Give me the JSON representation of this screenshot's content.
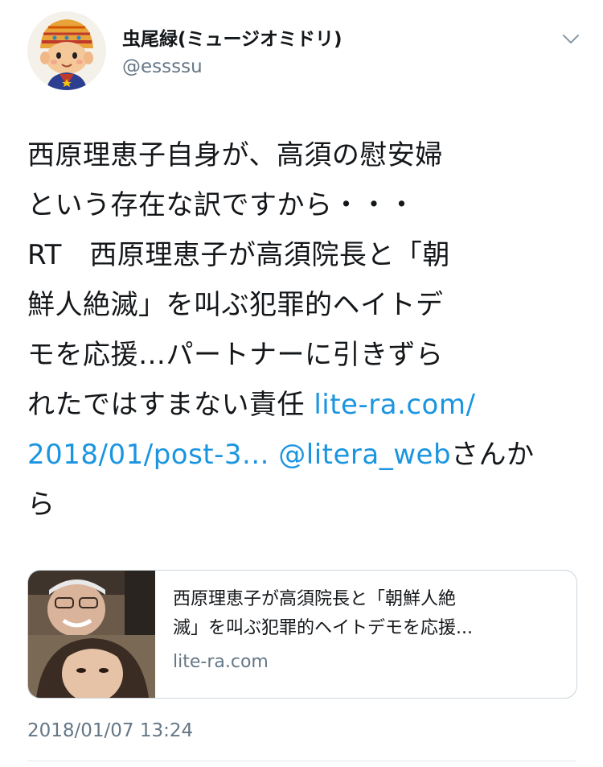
{
  "user": {
    "display_name": "虫尾緑(ミュージオミドリ)",
    "handle": "@essssu",
    "avatar_icon": "cartoon-boy-avatar-icon"
  },
  "menu": {
    "icon": "chevron-down-icon"
  },
  "tweet": {
    "lines": [
      "西原理恵子自身が、高須の慰安婦",
      "という存在な訳ですから・・・",
      "RT　西原理恵子が高須院長と「朝",
      "鮮人絶滅」を叫ぶ犯罪的ヘイトデ",
      "モを応援…パートナーに引きずら"
    ],
    "line6_text": "れたではすまない責任 ",
    "link_part1": "lite-ra.com/",
    "link_part2": "2018/01/post-3...",
    "mention": "@litera_web",
    "suffix": "さんか",
    "last_line": "ら"
  },
  "card": {
    "title_line1": "西原理恵子が高須院長と「朝鮮人絶",
    "title_line2": "滅」を叫ぶ犯罪的ヘイトデモを応援...",
    "domain": "lite-ra.com"
  },
  "timestamp": "2018/01/07 13:24",
  "colors": {
    "link": "#1b95e0",
    "text": "#14171a",
    "secondary": "#657786",
    "border": "#ccd6dd"
  }
}
